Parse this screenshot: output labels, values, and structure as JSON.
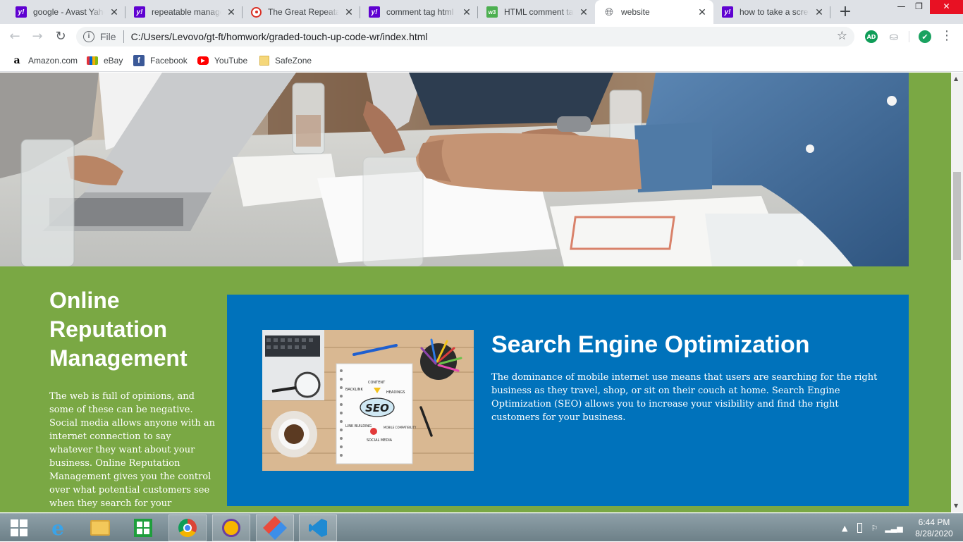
{
  "browser": {
    "tabs": [
      {
        "title": "google - Avast Yahoo",
        "icon": "yahoo-icon",
        "active": false
      },
      {
        "title": "repeatable management",
        "icon": "yahoo-icon",
        "active": false
      },
      {
        "title": "The Great Repeatable",
        "icon": "greatrepeatable-icon",
        "active": false
      },
      {
        "title": "comment tag html",
        "icon": "yahoo-icon",
        "active": false
      },
      {
        "title": "HTML comment tag",
        "icon": "w3schools-icon",
        "active": false
      },
      {
        "title": "website",
        "icon": "globe-icon",
        "active": true
      },
      {
        "title": "how to take a screenshot",
        "icon": "yahoo-icon",
        "active": false
      }
    ],
    "new_tab_glyph": "+",
    "address": {
      "scheme_label": "File",
      "url": "C:/Users/Levovo/gt-ft/homwork/graded-touch-up-code-wr/index.html"
    },
    "extensions": {
      "adblock_label": "AD"
    },
    "bookmarks": [
      {
        "label": "Amazon.com",
        "icon": "amazon-icon",
        "glyph": "a"
      },
      {
        "label": "eBay",
        "icon": "ebay-icon",
        "glyph": ""
      },
      {
        "label": "Facebook",
        "icon": "facebook-icon",
        "glyph": "f"
      },
      {
        "label": "YouTube",
        "icon": "youtube-icon",
        "glyph": "▶"
      },
      {
        "label": "SafeZone",
        "icon": "folder-icon",
        "glyph": ""
      }
    ]
  },
  "page": {
    "aside": {
      "heading": "Online Reputation Management",
      "body": "The web is full of opinions, and some of these can be negative. Social media allows anyone with an internet connection to say whatever they want about your business. Online Reputation Management gives you the control over what potential customers see when they search for your business."
    },
    "seo": {
      "heading": "Search Engine Optimization",
      "body": "The dominance of mobile internet use means that users are searching for the right business as they travel, shop, or sit on their couch at home. Search Engine Optimization (SEO) allows you to increase your visibility and find the right customers for your business.",
      "image_labels": {
        "center": "SEO",
        "content": "CONTENT",
        "backlink": "BACKLINK",
        "headings": "HEADINGS",
        "link_building": "LINK BUILDING",
        "mobile": "MOBILE COMPATIBILITY",
        "social": "SOCIAL MEDIA"
      }
    },
    "colors": {
      "page_bg": "#7aa844",
      "seo_bg": "#0072bb",
      "text": "#ffffff"
    }
  },
  "taskbar": {
    "time": "6:44 PM",
    "date": "8/28/2020",
    "apps": [
      "windows-start-icon",
      "internet-explorer-icon",
      "file-explorer-icon",
      "store-icon",
      "chrome-icon",
      "avast-browser-icon",
      "paint-app-icon",
      "vscode-icon"
    ]
  }
}
